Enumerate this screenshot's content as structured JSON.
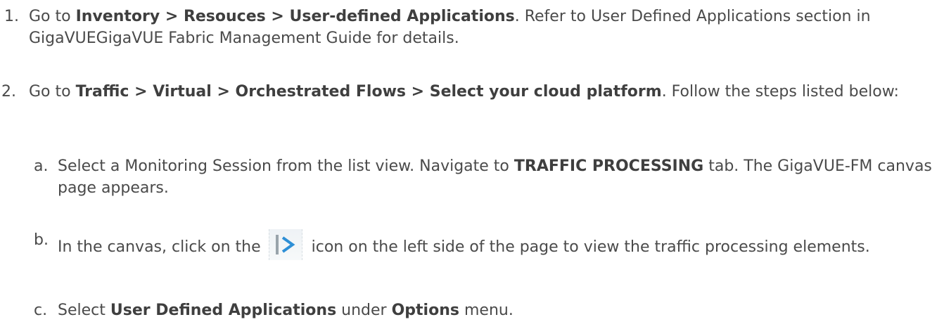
{
  "steps": [
    {
      "marker": "1.",
      "prefix": "Go to ",
      "path": "Inventory > Resouces > User-defined Applications",
      "suffix": ". Refer to User Defined Applications section in GigaVUEGigaVUE Fabric Management Guide for details."
    },
    {
      "marker": "2.",
      "prefix": "Go to ",
      "path": "Traffic > Virtual > Orchestrated Flows > Select your cloud platform",
      "suffix": ". Follow the steps listed below:",
      "substeps": [
        {
          "marker": "a.",
          "text1": "Select a Monitoring Session from the list view. Navigate to ",
          "bold1": "TRAFFIC PROCESSING",
          "text2": " tab. The GigaVUE-FM canvas page appears."
        },
        {
          "marker": "b.",
          "text1": "In the canvas, click on the ",
          "icon": "expand-panel-icon",
          "text2": " icon on the left side of the page to view the traffic processing elements."
        },
        {
          "marker": "c.",
          "text1": "Select ",
          "bold1": "User Defined Applications",
          "text2": " under ",
          "bold2": "Options",
          "text3": " menu."
        }
      ]
    }
  ],
  "colors": {
    "text": "#4a4a4a",
    "icon_bar": "#9aa4ab",
    "icon_arrow": "#2e8fd6"
  }
}
